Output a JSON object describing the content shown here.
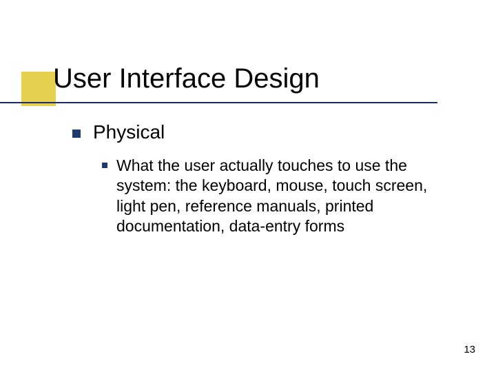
{
  "slide": {
    "title": "User Interface Design",
    "level1": {
      "text": "Physical"
    },
    "level2": {
      "text": "What the user actually touches to use the system: the keyboard, mouse, touch screen, light pen, reference manuals, printed documentation, data-entry forms"
    },
    "page_number": "13"
  }
}
